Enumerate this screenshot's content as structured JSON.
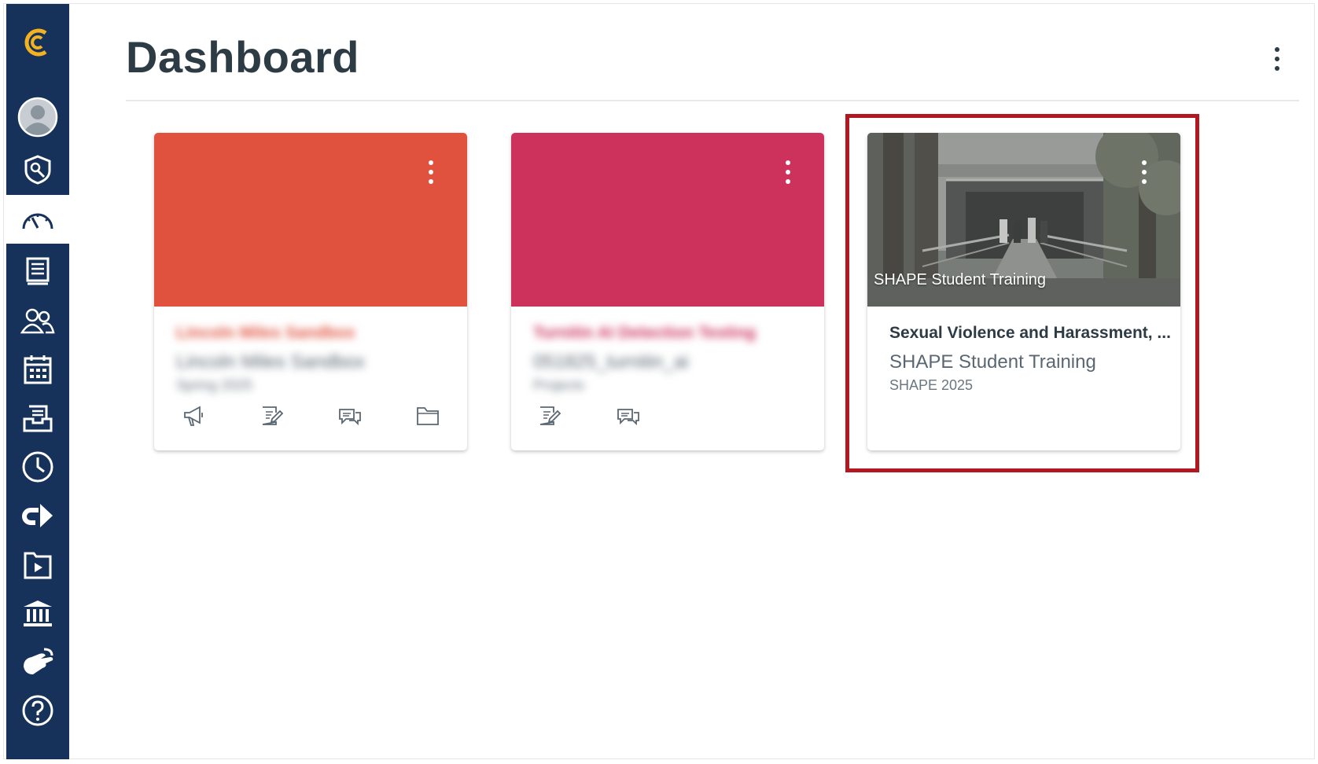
{
  "header": {
    "title": "Dashboard",
    "menu_icon": "kebab-icon"
  },
  "sidebar": {
    "items": [
      {
        "icon": "logo-icon",
        "label": ""
      },
      {
        "icon": "account-icon",
        "label": ""
      },
      {
        "icon": "admin-icon",
        "label": ""
      },
      {
        "icon": "dashboard-icon",
        "label": "",
        "active": true
      },
      {
        "icon": "courses-icon",
        "label": ""
      },
      {
        "icon": "groups-icon",
        "label": ""
      },
      {
        "icon": "calendar-icon",
        "label": ""
      },
      {
        "icon": "inbox-icon",
        "label": ""
      },
      {
        "icon": "history-icon",
        "label": ""
      },
      {
        "icon": "arrow-icon",
        "label": ""
      },
      {
        "icon": "studio-icon",
        "label": ""
      },
      {
        "icon": "commons-icon",
        "label": ""
      },
      {
        "icon": "handshake-icon",
        "label": ""
      },
      {
        "icon": "help-icon",
        "label": ""
      }
    ]
  },
  "cards": [
    {
      "color": "#e0523e",
      "title": "Lincoln Miles Sandbox",
      "subtitle": "Lincoln Miles Sandbox",
      "term": "Spring 2025",
      "title_color": "#e0523e",
      "blurred": true,
      "icons": [
        "announcements-icon",
        "assignments-icon",
        "discussions-icon",
        "files-icon"
      ]
    },
    {
      "color": "#cc325c",
      "title": "Turnitin AI Detection Testing",
      "subtitle": "051825_turnitin_ai",
      "term": "Projects",
      "title_color": "#cc325c",
      "blurred": true,
      "icons": [
        "assignments-icon",
        "discussions-icon"
      ]
    },
    {
      "color": "#6d6f70",
      "title": "Sexual Violence and Harassment, ...",
      "subtitle": "SHAPE Student Training",
      "term": "SHAPE 2025",
      "title_color": "#2d3b45",
      "blurred": false,
      "image_caption": "SHAPE Student Training",
      "icons": []
    }
  ],
  "colors": {
    "sidebar_bg": "#16325a",
    "logo_accent": "#f4b221",
    "highlight_border": "#b3171f"
  }
}
